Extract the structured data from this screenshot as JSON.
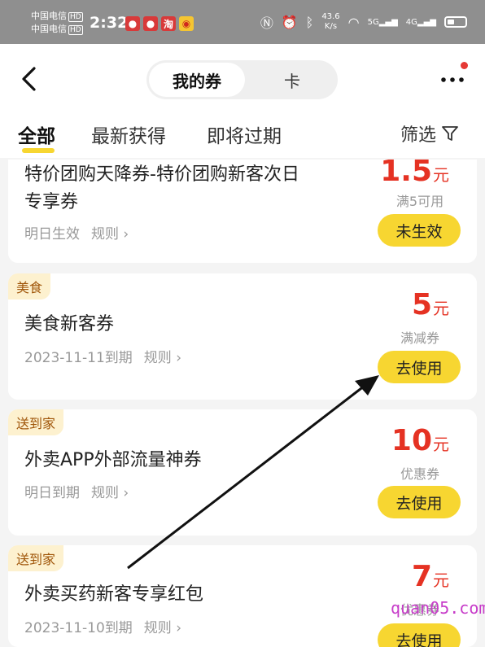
{
  "status_bar": {
    "carrier_1": "中国电信",
    "carrier_2": "中国电信",
    "hd": "HD",
    "time": "2:32",
    "taobao_icon_text": "淘",
    "net_speed_value": "43.6",
    "net_speed_unit": "K/s",
    "signal_1": "5G",
    "signal_2": "4G"
  },
  "header": {
    "segments": [
      "我的券",
      "卡"
    ],
    "tabs": [
      "全部",
      "最新获得",
      "即将过期"
    ],
    "filter_label": "筛选"
  },
  "coupons": [
    {
      "tag": "",
      "title_line1": "特价团购天降券-特价团购新客次日",
      "title_line2": "专享券",
      "meta": "明日生效",
      "rule": "规则 ›",
      "amount": "1.5",
      "unit": "元",
      "condition": "满5可用",
      "button": "未生效"
    },
    {
      "tag": "美食",
      "title_line1": "美食新客券",
      "meta": "2023-11-11到期",
      "rule": "规则 ›",
      "amount": "5",
      "unit": "元",
      "condition": "满减券",
      "button": "去使用"
    },
    {
      "tag": "送到家",
      "title_line1": "外卖APP外部流量神券",
      "meta": "明日到期",
      "rule": "规则 ›",
      "amount": "10",
      "unit": "元",
      "condition": "优惠券",
      "button": "去使用"
    },
    {
      "tag": "送到家",
      "title_line1": "外卖买药新客专享红包",
      "meta": "2023-11-10到期",
      "rule": "规则 ›",
      "amount": "7",
      "unit": "元",
      "condition": "优惠券",
      "button": "去使用"
    }
  ],
  "watermark": "quan05.com",
  "colors": {
    "accent_yellow": "#f7d631",
    "price_red": "#e53223",
    "tag_bg": "#fdf1cf"
  }
}
